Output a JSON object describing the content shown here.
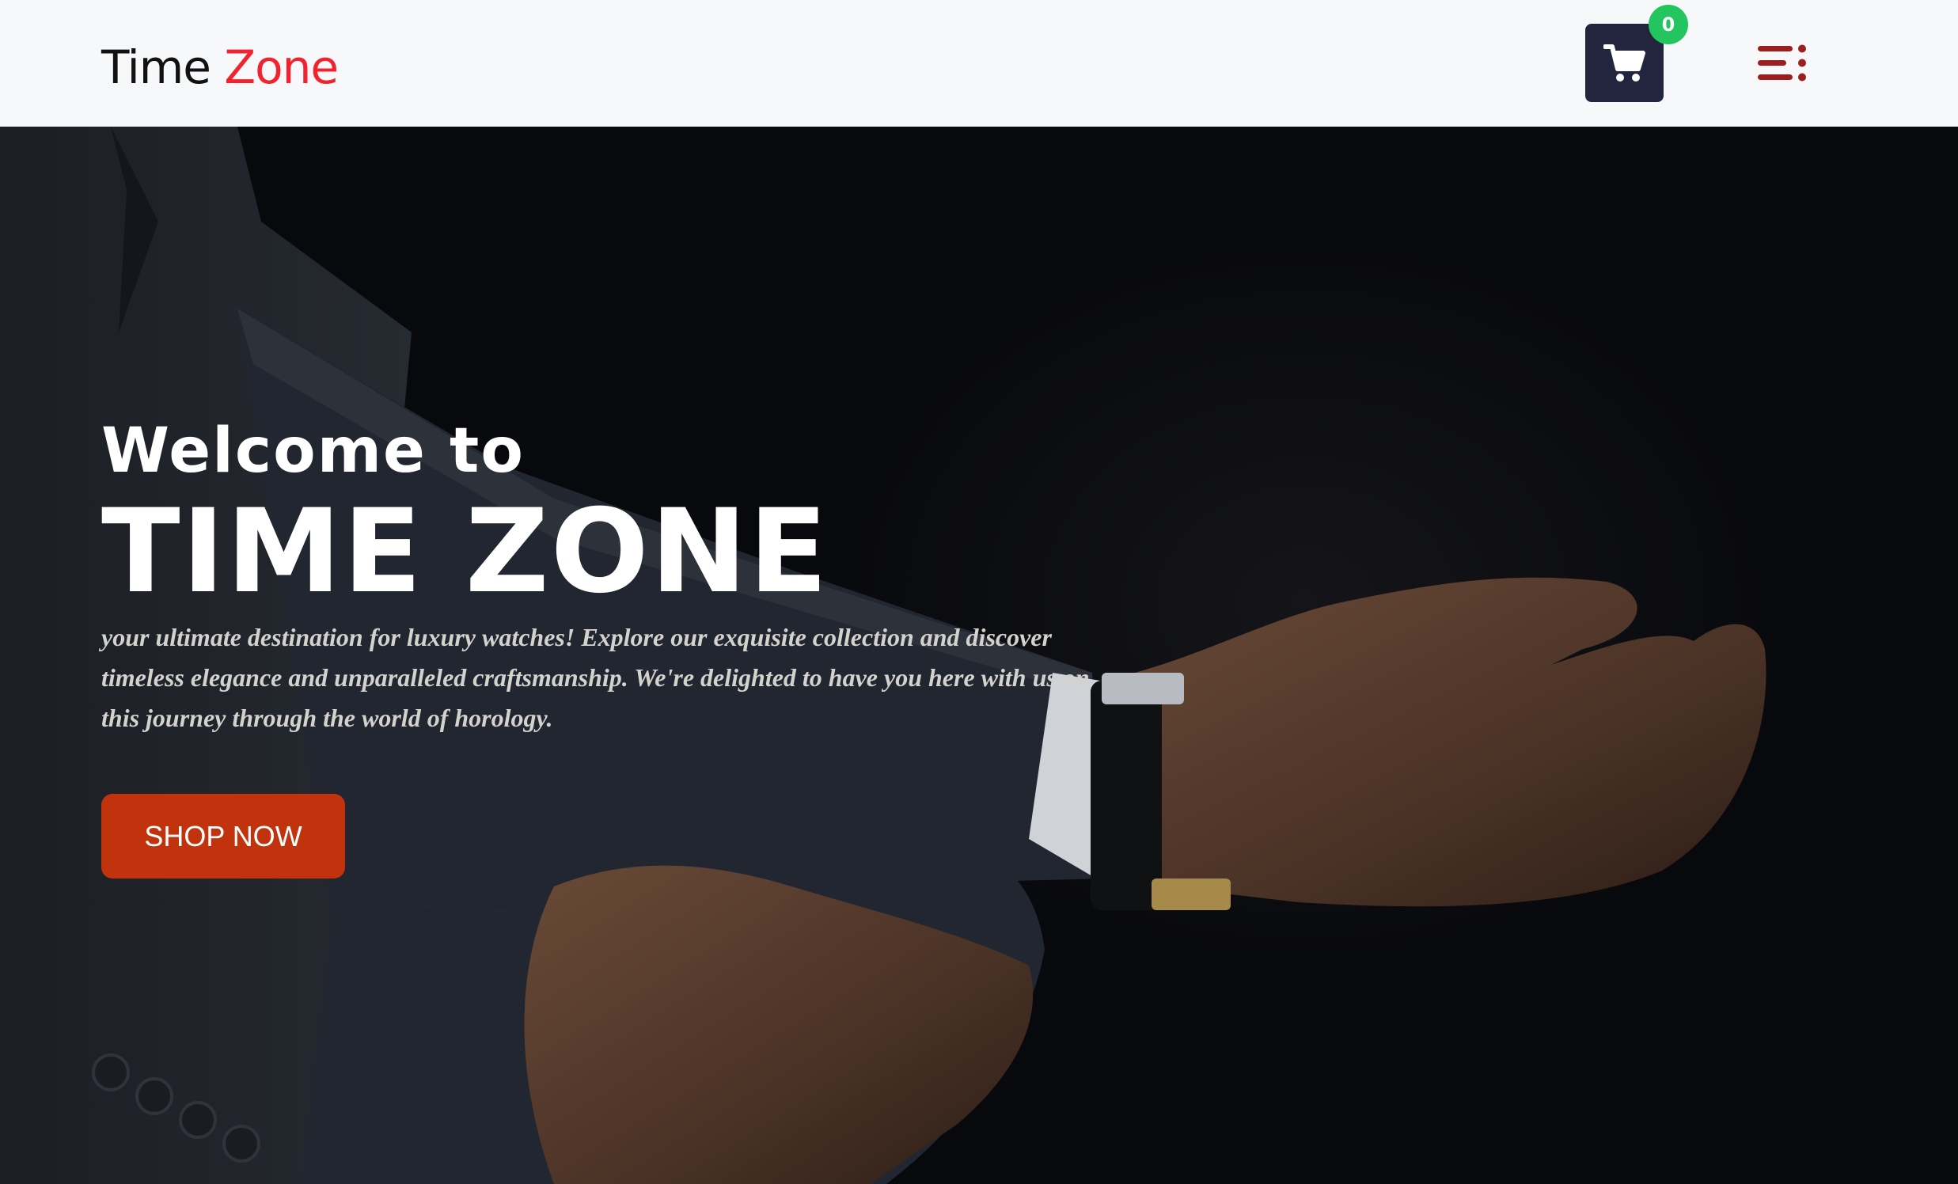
{
  "header": {
    "logo": {
      "part1": "Time",
      "part2": "Zone"
    },
    "cart": {
      "icon": "shopping-cart-icon",
      "badge_count": "0"
    },
    "menu": {
      "icon": "menu-icon"
    }
  },
  "hero": {
    "welcome": "Welcome to",
    "title": "TIME ZONE",
    "tagline": "your ultimate destination for luxury watches! Explore our exquisite collection and discover timeless elegance and unparalleled craftsmanship. We're delighted to have you here with us on this journey through the world of horology.",
    "cta_label": "SHOP NOW",
    "background_image": "man-in-suit-adjusting-wristwatch-photo"
  },
  "colors": {
    "logo_accent": "#f0232e",
    "cart_bg": "#22253d",
    "badge_bg": "#22c55e",
    "menu_icon": "#9c1f1f",
    "cta_bg": "#c0330c",
    "nav_bg": "#f7f8fa"
  }
}
